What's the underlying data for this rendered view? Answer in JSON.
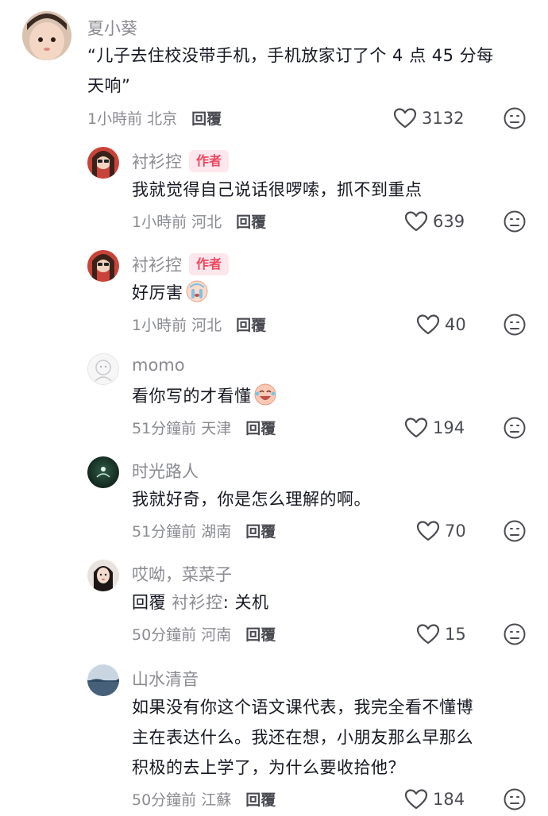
{
  "comments": [
    {
      "username": "夏小葵",
      "text_lines": [
        "“儿子去住校没带手机，手机放家订了个 4 点 45 分每",
        "天响”"
      ],
      "time": "1小時前",
      "location": "北京",
      "reply_label": "回覆",
      "likes": "3132"
    },
    {
      "username": "衬衫控",
      "badge": "作者",
      "text": "我就觉得自己说话很啰嗦，抓不到重点",
      "time": "1小時前",
      "location": "河北",
      "reply_label": "回覆",
      "likes": "639"
    },
    {
      "username": "衬衫控",
      "badge": "作者",
      "text": "好厉害",
      "emoji": "crying-face-emoji",
      "time": "1小時前",
      "location": "河北",
      "reply_label": "回覆",
      "likes": "40"
    },
    {
      "username": "momo",
      "text": "看你写的才看懂",
      "emoji": "crying-laugh-emoji",
      "time": "51分鐘前",
      "location": "天津",
      "reply_label": "回覆",
      "likes": "194"
    },
    {
      "username": "时光路人",
      "text": "我就好奇，你是怎么理解的啊。",
      "time": "51分鐘前",
      "location": "湖南",
      "reply_label": "回覆",
      "likes": "70"
    },
    {
      "username": "哎呦，菜菜子",
      "reply_prefix": "回覆",
      "reply_target": "衬衫控",
      "text": ": 关机",
      "time": "50分鐘前",
      "location": "河南",
      "reply_label": "回覆",
      "likes": "15"
    },
    {
      "username": "山水清音",
      "text_lines": [
        "如果没有你这个语文课代表，我完全看不懂博",
        "主在表达什么。我还在想，小朋友那么早那么",
        "积极的去上学了，为什么要收拾他？"
      ],
      "time": "50分鐘前",
      "location": "江蘇",
      "reply_label": "回覆",
      "likes": "184"
    }
  ],
  "colors": {
    "text": "#161823",
    "muted": "#8a8b91",
    "badge_bg": "#fde7ec",
    "badge_text": "#f0465e"
  },
  "icons": {
    "like": "heart-outline-icon",
    "dislike": "neutral-face-icon"
  }
}
